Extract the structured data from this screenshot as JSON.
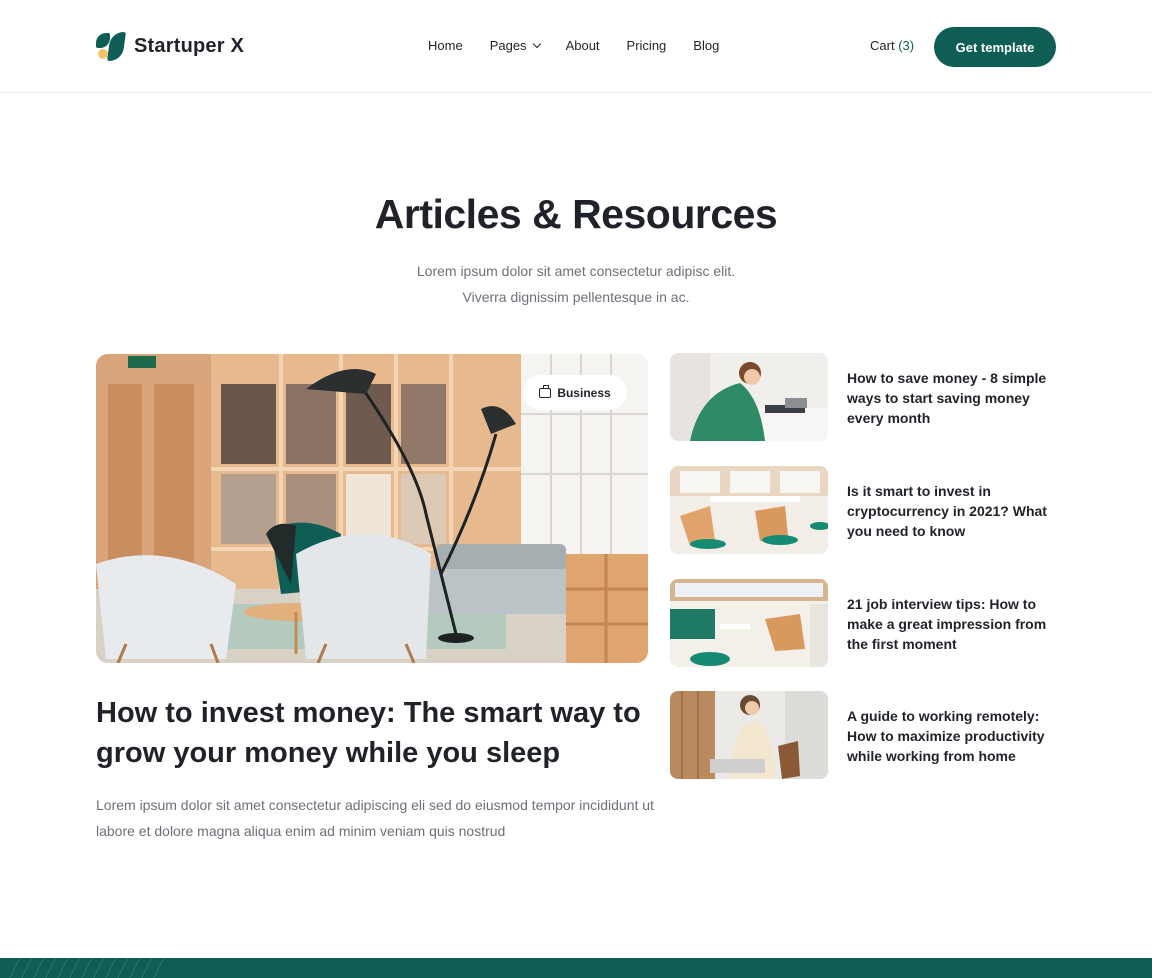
{
  "header": {
    "brand": "Startuper X",
    "nav": [
      {
        "label": "Home"
      },
      {
        "label": "Pages"
      },
      {
        "label": "About"
      },
      {
        "label": "Pricing"
      },
      {
        "label": "Blog"
      }
    ],
    "cart_label": "Cart",
    "cart_count": "(3)",
    "cta_label": "Get template"
  },
  "section": {
    "title": "Articles & Resources",
    "subtitle_line1": "Lorem ipsum dolor sit amet consectetur adipisc elit.",
    "subtitle_line2": "Viverra dignissim pellentesque in ac."
  },
  "featured": {
    "tag": "Business",
    "title": "How to invest money: The smart way to grow your money while you sleep",
    "excerpt": "Lorem ipsum dolor sit amet consectetur adipiscing eli sed do eiusmod tempor incididunt ut labore et dolore magna aliqua enim ad minim veniam quis nostrud"
  },
  "articles": [
    {
      "title": "How to save money - 8 simple ways to start saving money every month"
    },
    {
      "title": "Is it smart to invest in cryptocurrency in 2021?  What you need to know"
    },
    {
      "title": "21 job interview tips: How to make a great impression from the first moment"
    },
    {
      "title": "A guide to working remotely: How to maximize productivity while working from home"
    }
  ],
  "colors": {
    "brand": "#0e5e55",
    "accent": "#f6c36b",
    "text": "#1f2329",
    "muted": "#6b7079"
  }
}
